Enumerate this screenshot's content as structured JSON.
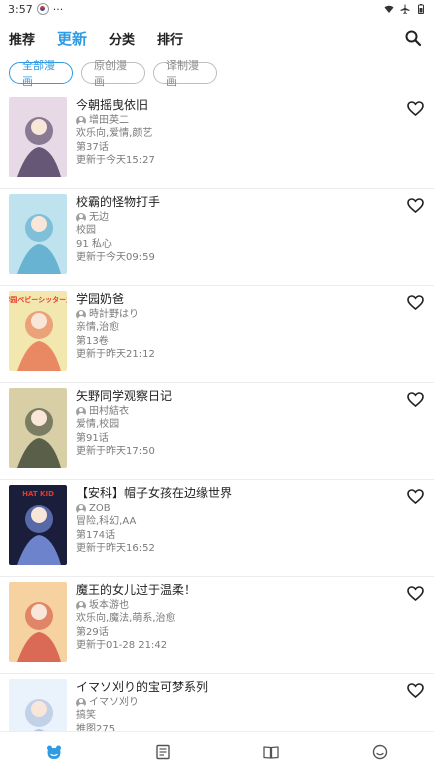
{
  "status_bar": {
    "time": "3:57",
    "dots": "···"
  },
  "top_tabs": [
    {
      "label": "推荐",
      "active": false
    },
    {
      "label": "更新",
      "active": true
    },
    {
      "label": "分类",
      "active": false
    },
    {
      "label": "排行",
      "active": false
    }
  ],
  "filters": [
    {
      "label": "全部漫画",
      "active": true
    },
    {
      "label": "原创漫画",
      "active": false
    },
    {
      "label": "译制漫画",
      "active": false
    }
  ],
  "items": [
    {
      "title": "今朝摇曳依旧",
      "author": "增田英二",
      "tags": "欢乐向,爱情,颜艺",
      "chapter": "第37话",
      "updated": "更新于今天15:27"
    },
    {
      "title": "校霸的怪物打手",
      "author": "无边",
      "tags": "校园",
      "chapter": "91 私心",
      "updated": "更新于今天09:59"
    },
    {
      "title": "学园奶爸",
      "author": "時計野はり",
      "tags": "亲情,治愈",
      "chapter": "第13卷",
      "updated": "更新于昨天21:12"
    },
    {
      "title": "矢野同学观察日记",
      "author": "田村結衣",
      "tags": "爱情,校园",
      "chapter": "第91话",
      "updated": "更新于昨天17:50"
    },
    {
      "title": "【安科】帽子女孩在边缘世界",
      "author": "ZOB",
      "tags": "冒险,科幻,AA",
      "chapter": "第174话",
      "updated": "更新于昨天16:52"
    },
    {
      "title": "魔王的女儿过于温柔！",
      "author": "坂本游也",
      "tags": "欢乐向,魔法,萌系,治愈",
      "chapter": "第29话",
      "updated": "更新于01-28 21:42"
    },
    {
      "title": "イマソ刈り的宝可梦系列",
      "author": "イマソ刈り",
      "tags": "搞笑",
      "chapter": "推图275",
      "updated": ""
    }
  ],
  "covers": [
    {
      "cover_text": "",
      "bg": "#e8d9e6",
      "accent": "#3a2b4f"
    },
    {
      "cover_text": "",
      "bg": "#bfe3ee",
      "accent": "#4aa3c7"
    },
    {
      "cover_text": "学园ベビーシッターズ",
      "bg": "#f3e7b0",
      "accent": "#e46a4a"
    },
    {
      "cover_text": "",
      "bg": "#d9cfa7",
      "accent": "#2d3a2a"
    },
    {
      "cover_text": "HAT KID",
      "bg": "#1a1e3b",
      "accent": "#8aa7ff"
    },
    {
      "cover_text": "",
      "bg": "#f6d2a0",
      "accent": "#d0463c"
    },
    {
      "cover_text": "",
      "bg": "#eaf2fb",
      "accent": "#9fb6d9"
    }
  ],
  "colors": {
    "accent": "#2f9be3",
    "text": "#222222",
    "muted": "#7a7a7a"
  },
  "bottom_nav": [
    {
      "icon": "bear-icon",
      "active": true
    },
    {
      "icon": "list-icon",
      "active": false
    },
    {
      "icon": "book-icon",
      "active": false
    },
    {
      "icon": "smile-icon",
      "active": false
    }
  ]
}
